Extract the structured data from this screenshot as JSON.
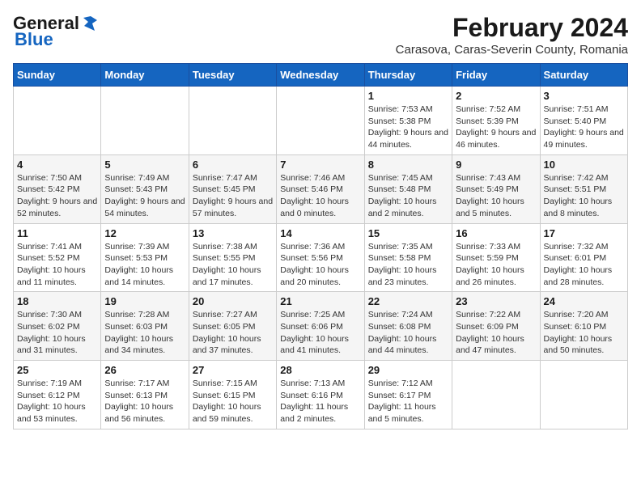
{
  "header": {
    "logo_general": "General",
    "logo_blue": "Blue",
    "main_title": "February 2024",
    "subtitle": "Carasova, Caras-Severin County, Romania"
  },
  "weekdays": [
    "Sunday",
    "Monday",
    "Tuesday",
    "Wednesday",
    "Thursday",
    "Friday",
    "Saturday"
  ],
  "weeks": [
    [
      {
        "day": "",
        "info": ""
      },
      {
        "day": "",
        "info": ""
      },
      {
        "day": "",
        "info": ""
      },
      {
        "day": "",
        "info": ""
      },
      {
        "day": "1",
        "info": "Sunrise: 7:53 AM\nSunset: 5:38 PM\nDaylight: 9 hours\nand 44 minutes."
      },
      {
        "day": "2",
        "info": "Sunrise: 7:52 AM\nSunset: 5:39 PM\nDaylight: 9 hours\nand 46 minutes."
      },
      {
        "day": "3",
        "info": "Sunrise: 7:51 AM\nSunset: 5:40 PM\nDaylight: 9 hours\nand 49 minutes."
      }
    ],
    [
      {
        "day": "4",
        "info": "Sunrise: 7:50 AM\nSunset: 5:42 PM\nDaylight: 9 hours\nand 52 minutes."
      },
      {
        "day": "5",
        "info": "Sunrise: 7:49 AM\nSunset: 5:43 PM\nDaylight: 9 hours\nand 54 minutes."
      },
      {
        "day": "6",
        "info": "Sunrise: 7:47 AM\nSunset: 5:45 PM\nDaylight: 9 hours\nand 57 minutes."
      },
      {
        "day": "7",
        "info": "Sunrise: 7:46 AM\nSunset: 5:46 PM\nDaylight: 10 hours\nand 0 minutes."
      },
      {
        "day": "8",
        "info": "Sunrise: 7:45 AM\nSunset: 5:48 PM\nDaylight: 10 hours\nand 2 minutes."
      },
      {
        "day": "9",
        "info": "Sunrise: 7:43 AM\nSunset: 5:49 PM\nDaylight: 10 hours\nand 5 minutes."
      },
      {
        "day": "10",
        "info": "Sunrise: 7:42 AM\nSunset: 5:51 PM\nDaylight: 10 hours\nand 8 minutes."
      }
    ],
    [
      {
        "day": "11",
        "info": "Sunrise: 7:41 AM\nSunset: 5:52 PM\nDaylight: 10 hours\nand 11 minutes."
      },
      {
        "day": "12",
        "info": "Sunrise: 7:39 AM\nSunset: 5:53 PM\nDaylight: 10 hours\nand 14 minutes."
      },
      {
        "day": "13",
        "info": "Sunrise: 7:38 AM\nSunset: 5:55 PM\nDaylight: 10 hours\nand 17 minutes."
      },
      {
        "day": "14",
        "info": "Sunrise: 7:36 AM\nSunset: 5:56 PM\nDaylight: 10 hours\nand 20 minutes."
      },
      {
        "day": "15",
        "info": "Sunrise: 7:35 AM\nSunset: 5:58 PM\nDaylight: 10 hours\nand 23 minutes."
      },
      {
        "day": "16",
        "info": "Sunrise: 7:33 AM\nSunset: 5:59 PM\nDaylight: 10 hours\nand 26 minutes."
      },
      {
        "day": "17",
        "info": "Sunrise: 7:32 AM\nSunset: 6:01 PM\nDaylight: 10 hours\nand 28 minutes."
      }
    ],
    [
      {
        "day": "18",
        "info": "Sunrise: 7:30 AM\nSunset: 6:02 PM\nDaylight: 10 hours\nand 31 minutes."
      },
      {
        "day": "19",
        "info": "Sunrise: 7:28 AM\nSunset: 6:03 PM\nDaylight: 10 hours\nand 34 minutes."
      },
      {
        "day": "20",
        "info": "Sunrise: 7:27 AM\nSunset: 6:05 PM\nDaylight: 10 hours\nand 37 minutes."
      },
      {
        "day": "21",
        "info": "Sunrise: 7:25 AM\nSunset: 6:06 PM\nDaylight: 10 hours\nand 41 minutes."
      },
      {
        "day": "22",
        "info": "Sunrise: 7:24 AM\nSunset: 6:08 PM\nDaylight: 10 hours\nand 44 minutes."
      },
      {
        "day": "23",
        "info": "Sunrise: 7:22 AM\nSunset: 6:09 PM\nDaylight: 10 hours\nand 47 minutes."
      },
      {
        "day": "24",
        "info": "Sunrise: 7:20 AM\nSunset: 6:10 PM\nDaylight: 10 hours\nand 50 minutes."
      }
    ],
    [
      {
        "day": "25",
        "info": "Sunrise: 7:19 AM\nSunset: 6:12 PM\nDaylight: 10 hours\nand 53 minutes."
      },
      {
        "day": "26",
        "info": "Sunrise: 7:17 AM\nSunset: 6:13 PM\nDaylight: 10 hours\nand 56 minutes."
      },
      {
        "day": "27",
        "info": "Sunrise: 7:15 AM\nSunset: 6:15 PM\nDaylight: 10 hours\nand 59 minutes."
      },
      {
        "day": "28",
        "info": "Sunrise: 7:13 AM\nSunset: 6:16 PM\nDaylight: 11 hours\nand 2 minutes."
      },
      {
        "day": "29",
        "info": "Sunrise: 7:12 AM\nSunset: 6:17 PM\nDaylight: 11 hours\nand 5 minutes."
      },
      {
        "day": "",
        "info": ""
      },
      {
        "day": "",
        "info": ""
      }
    ]
  ]
}
